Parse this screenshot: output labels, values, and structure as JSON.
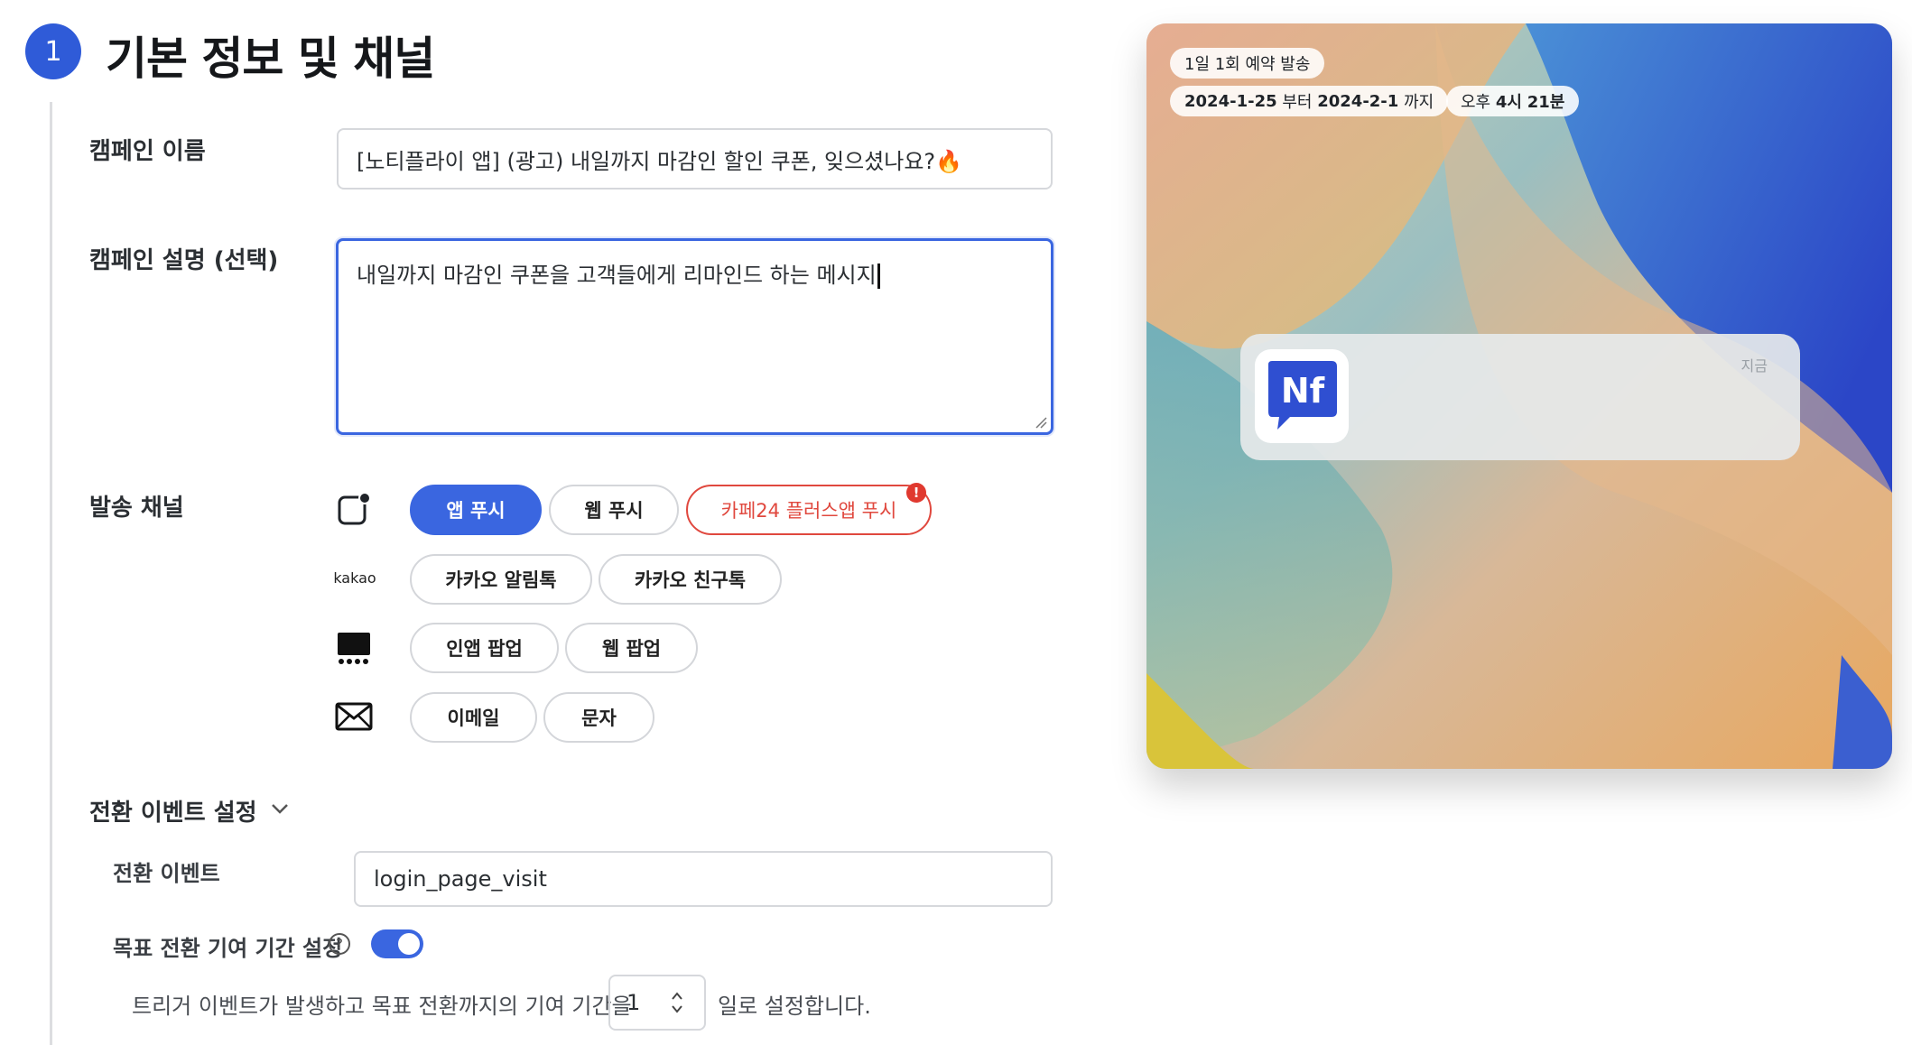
{
  "section": {
    "step": "1",
    "title": "기본 정보 및 채널"
  },
  "campaign_name": {
    "label": "캠페인 이름",
    "value": "[노티플라이 앱] (광고) 내일까지 마감인 할인 쿠폰, 잊으셨나요?🔥"
  },
  "campaign_desc": {
    "label": "캠페인 설명 (선택)",
    "value": "내일까지 마감인 쿠폰을 고객들에게 리마인드 하는 메시지"
  },
  "channels": {
    "label": "발송 채널",
    "push": [
      "앱 푸시",
      "웹 푸시",
      "카페24 플러스앱 푸시"
    ],
    "push_warning": "!",
    "kakao_label": "kakao",
    "kakao": [
      "카카오 알림톡",
      "카카오 친구톡"
    ],
    "popup": [
      "인앱 팝업",
      "웹 팝업"
    ],
    "message": [
      "이메일",
      "문자"
    ]
  },
  "conversion": {
    "section_label": "전환 이벤트 설정",
    "event_label": "전환 이벤트",
    "event_value": "login_page_visit",
    "goal_label": "목표 전환 기여 기간 설정",
    "help": "?",
    "toggle_on": true,
    "desc_before": "트리거 이벤트가 발생하고 목표 전환까지의 기여 기간을",
    "days_value": "1",
    "desc_after": "일로 설정합니다."
  },
  "preview": {
    "schedule_badge": "1일 1회 예약 발송",
    "date_start": "2024-1-25",
    "date_from": "부터",
    "date_end": "2024-2-1",
    "date_to": "까지",
    "time_prefix": "오후",
    "time_hour": "4시",
    "time_min": "21분",
    "notification_time": "지금",
    "app_icon_text": "Nf"
  },
  "colors": {
    "accent": "#3a66e0",
    "warning": "#e0483e",
    "text": "#2b2f33"
  }
}
